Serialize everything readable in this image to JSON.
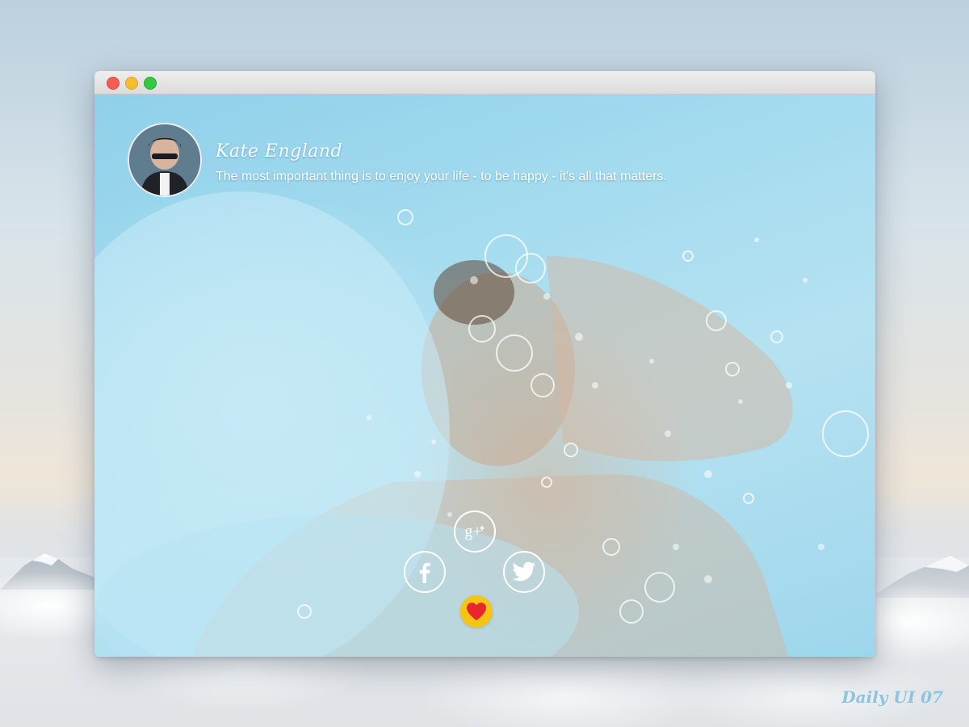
{
  "window": {
    "controls": [
      "close",
      "minimize",
      "maximize"
    ],
    "controls_colors": {
      "close": "#f45d56",
      "minimize": "#f8bd2e",
      "maximize": "#34c940"
    }
  },
  "profile": {
    "name": "Kate England",
    "quote": "The most important thing is to enjoy your life - to be happy - it's all that matters.",
    "avatar_icon": "avatar-photo"
  },
  "social": {
    "buttons": [
      {
        "id": "google-plus",
        "icon": "google-plus-icon",
        "glyph": "g+"
      },
      {
        "id": "facebook",
        "icon": "facebook-icon",
        "glyph": "f"
      },
      {
        "id": "twitter",
        "icon": "twitter-icon"
      }
    ],
    "like": {
      "icon": "heart-icon",
      "color": "#e8262d",
      "background": "#f6c514"
    }
  },
  "branding": {
    "label": "Daily UI 07"
  },
  "colors": {
    "accent": "#ffffff",
    "water": "#a6dcef",
    "brand_text": "#8fc3e0"
  }
}
